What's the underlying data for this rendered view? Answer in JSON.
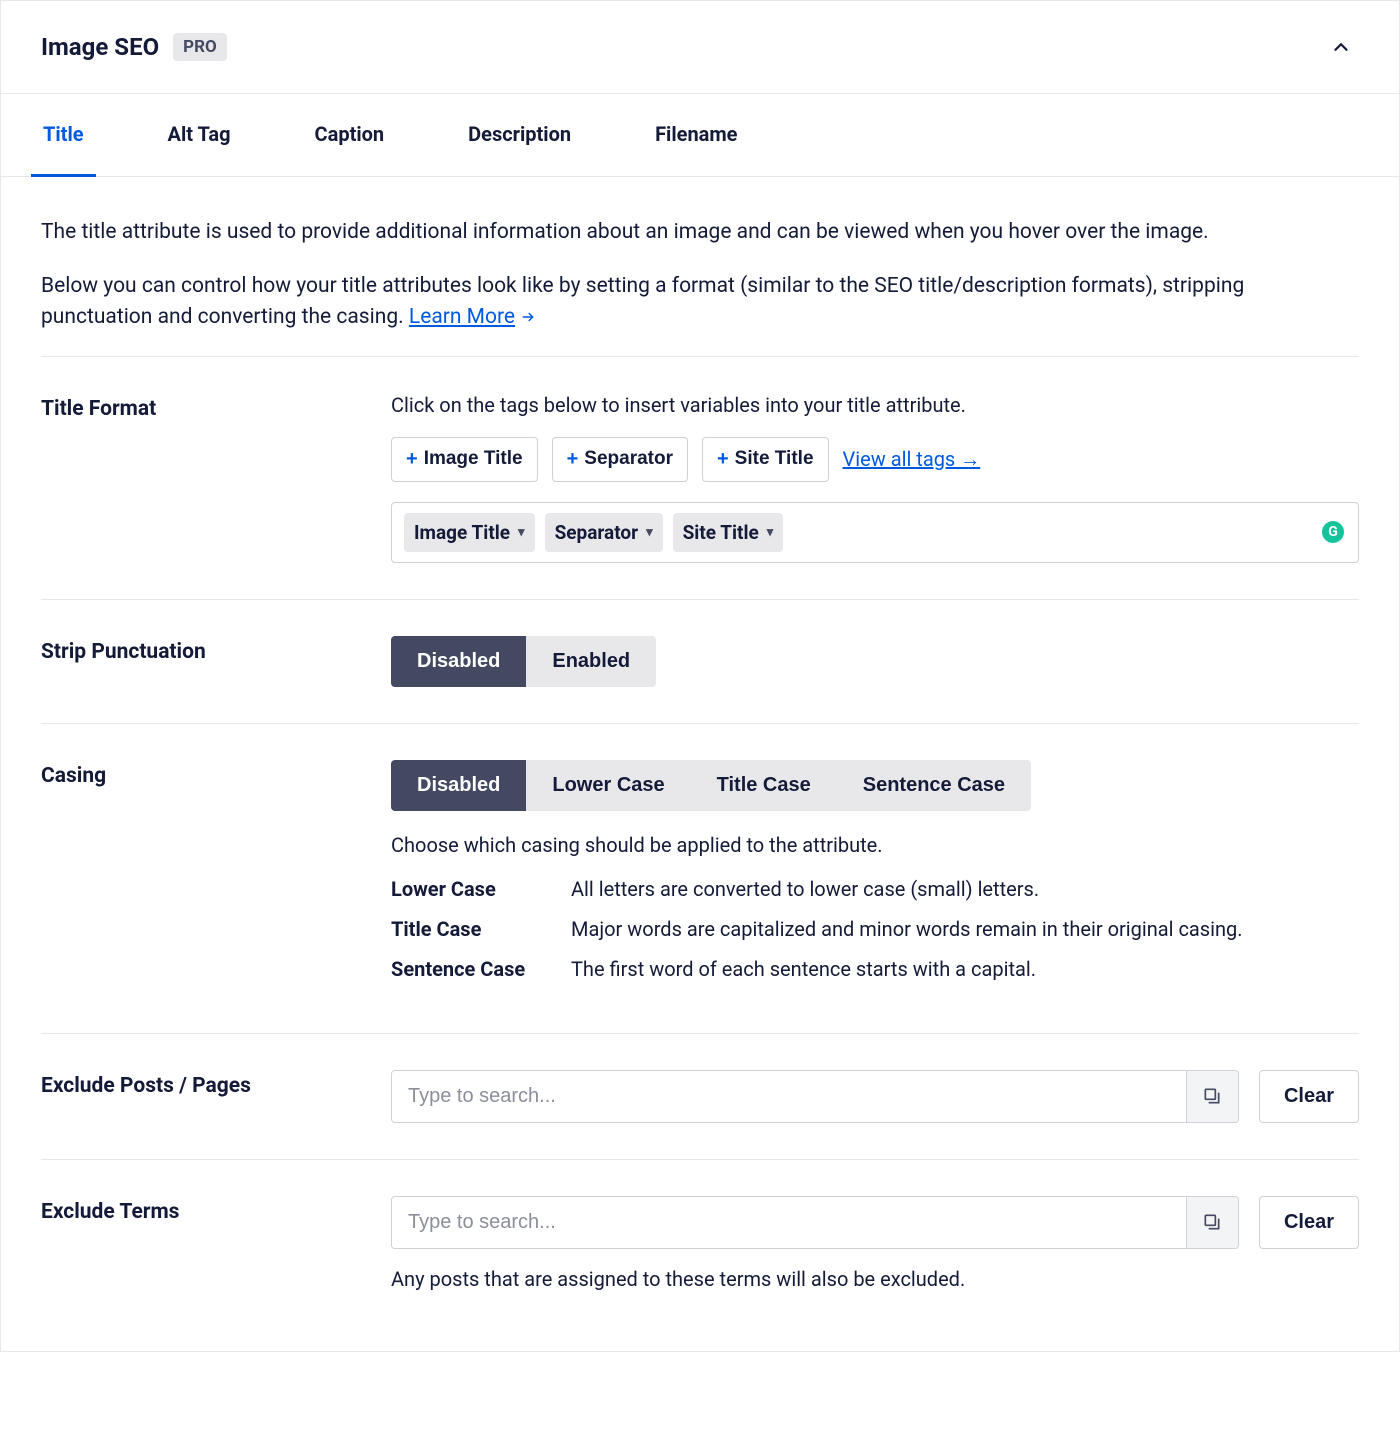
{
  "header": {
    "title": "Image SEO",
    "badge": "PRO"
  },
  "tabs": [
    "Title",
    "Alt Tag",
    "Caption",
    "Description",
    "Filename"
  ],
  "active_tab": 0,
  "intro": {
    "p1": "The title attribute is used to provide additional information about an image and can be viewed when you hover over the image.",
    "p2_before": "Below you can control how your title attributes look like by setting a format (similar to the SEO title/description formats), stripping punctuation and converting the casing. ",
    "learn_more": "Learn More"
  },
  "title_format": {
    "label": "Title Format",
    "helper": "Click on the tags below to insert variables into your title attribute.",
    "tag_buttons": [
      "Image Title",
      "Separator",
      "Site Title"
    ],
    "view_all": "View all tags →",
    "chips": [
      "Image Title",
      "Separator",
      "Site Title"
    ]
  },
  "strip_punctuation": {
    "label": "Strip Punctuation",
    "options": [
      "Disabled",
      "Enabled"
    ],
    "active": 0
  },
  "casing": {
    "label": "Casing",
    "options": [
      "Disabled",
      "Lower Case",
      "Title Case",
      "Sentence Case"
    ],
    "active": 0,
    "helper": "Choose which casing should be applied to the attribute.",
    "rows": [
      {
        "name": "Lower Case",
        "desc": "All letters are converted to lower case (small) letters."
      },
      {
        "name": "Title Case",
        "desc": "Major words are capitalized and minor words remain in their original casing."
      },
      {
        "name": "Sentence Case",
        "desc": "The first word of each sentence starts with a capital."
      }
    ]
  },
  "exclude_posts": {
    "label": "Exclude Posts / Pages",
    "placeholder": "Type to search...",
    "clear": "Clear"
  },
  "exclude_terms": {
    "label": "Exclude Terms",
    "placeholder": "Type to search...",
    "clear": "Clear",
    "helper": "Any posts that are assigned to these terms will also be excluded."
  }
}
